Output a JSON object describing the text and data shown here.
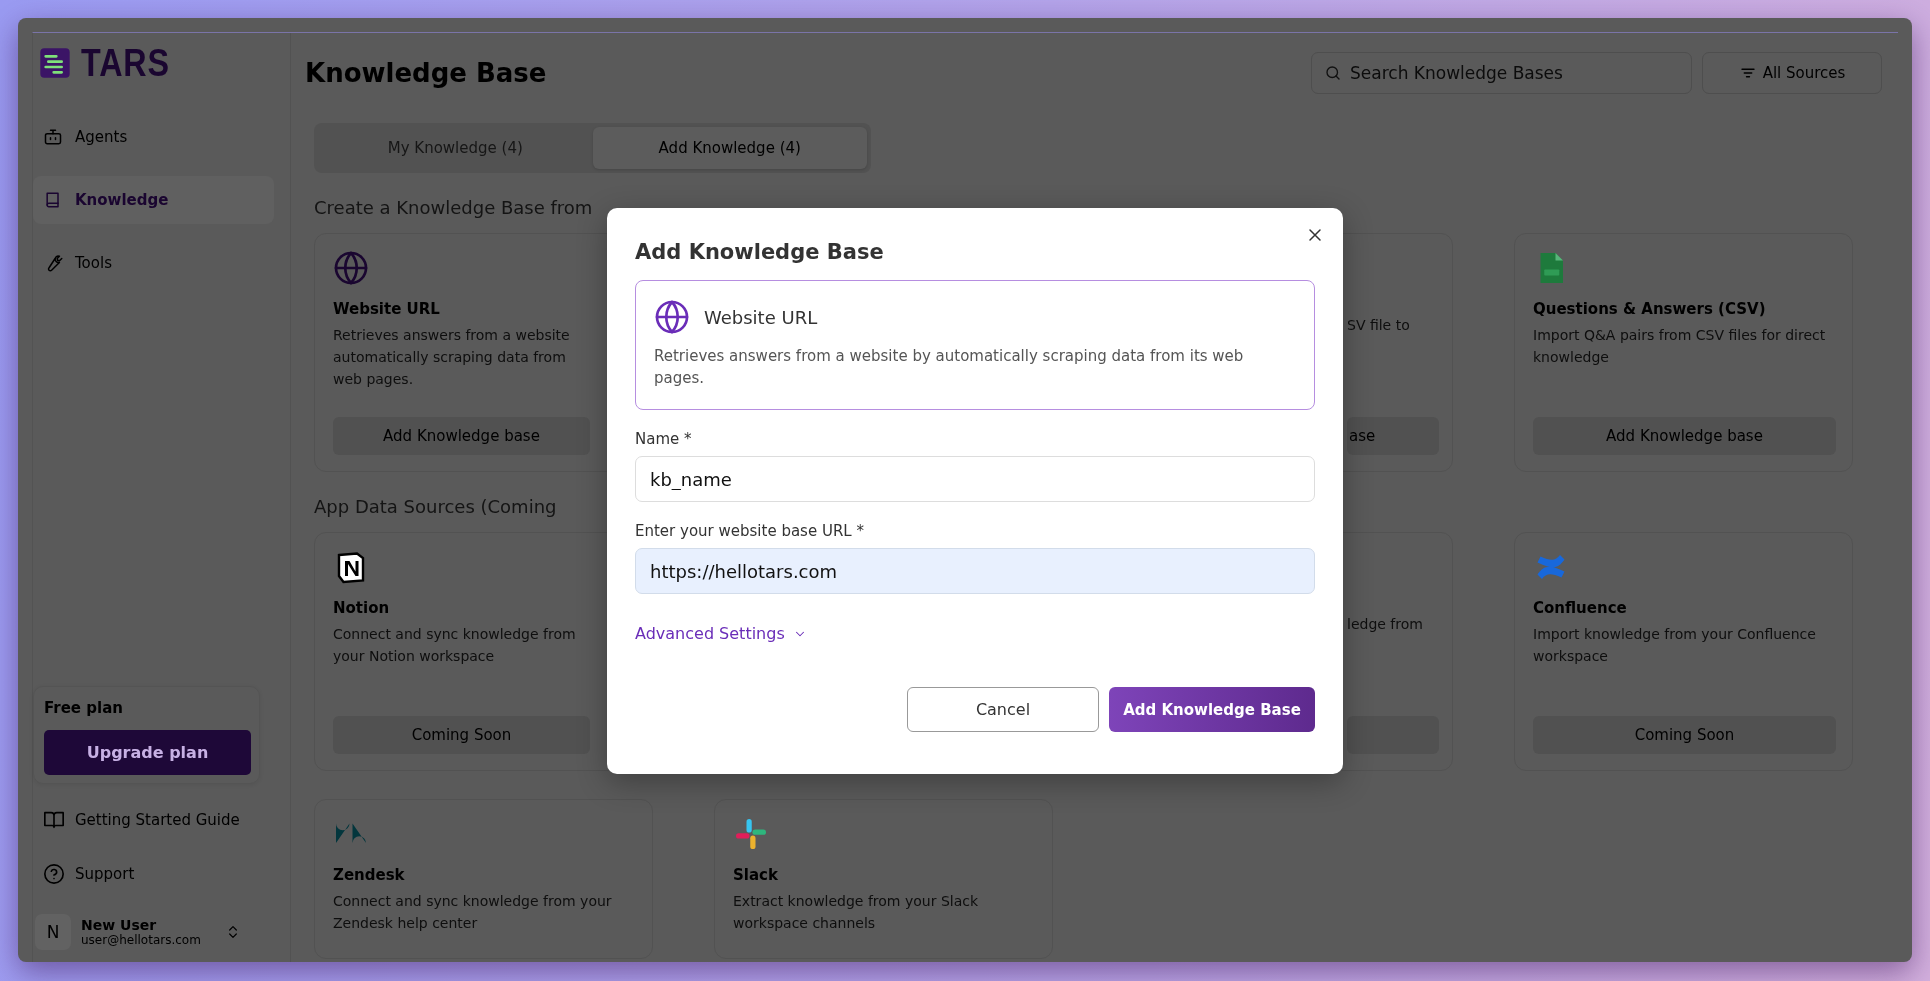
{
  "sidebar": {
    "logo": "TARS",
    "nav": [
      {
        "label": "Agents",
        "selected": false
      },
      {
        "label": "Knowledge",
        "selected": true
      },
      {
        "label": "Tools",
        "selected": false
      }
    ],
    "plan": {
      "title": "Free plan",
      "button": "Upgrade plan"
    },
    "links": [
      "Getting Started Guide",
      "Support"
    ],
    "user": {
      "initial": "N",
      "name": "New User",
      "email": "user@hellotars.com"
    }
  },
  "header": {
    "title": "Knowledge Base",
    "search": {
      "placeholder": "Search Knowledge Bases"
    },
    "filter": "All Sources"
  },
  "tabs": [
    {
      "label": "My Knowledge (4)",
      "selected": false
    },
    {
      "label": "Add Knowledge (4)",
      "selected": true
    }
  ],
  "sections": [
    {
      "heading": "Create a Knowledge Base from",
      "cards": [
        {
          "kind": "globe",
          "title": "Website URL",
          "description": "Retrieves answers from a website automatically scraping data from web pages.",
          "button": "Add Knowledge base",
          "clipped": true
        },
        {
          "kind": "covered"
        },
        {
          "kind": "partial",
          "description": "SV file to",
          "button": "ase"
        },
        {
          "kind": "csv",
          "title": "Questions & Answers (CSV)",
          "description": "Import Q&A pairs from CSV files for direct knowledge",
          "button": "Add Knowledge base"
        }
      ]
    },
    {
      "heading": "App Data Sources (Coming",
      "cards": [
        {
          "kind": "notion",
          "title": "Notion",
          "description": "Connect and sync knowledge from your Notion workspace",
          "button": "Coming Soon",
          "clipped": true
        },
        {
          "kind": "covered"
        },
        {
          "kind": "partial",
          "description": "ledge from",
          "has_button": true
        },
        {
          "kind": "confluence",
          "title": "Confluence",
          "description": "Import knowledge from your Confluence workspace",
          "button": "Coming Soon"
        },
        {
          "kind": "zendesk",
          "title": "Zendesk",
          "description": "Connect and sync knowledge from your Zendesk help center"
        },
        {
          "kind": "slack",
          "title": "Slack",
          "description": "Extract knowledge from your Slack workspace channels"
        }
      ]
    }
  ],
  "modal": {
    "title": "Add Knowledge Base",
    "source": {
      "kind": "globe",
      "title": "Website URL",
      "description": "Retrieves answers from a website by automatically scraping data from its web pages."
    },
    "fields": [
      {
        "label": "Name *",
        "value": "kb_name",
        "autofilled": false
      },
      {
        "label": "Enter your website base URL *",
        "value": "https://hellotars.com",
        "autofilled": true
      }
    ],
    "advanced": {
      "label": "Advanced Settings",
      "expanded": false
    },
    "buttons": [
      {
        "label": "Cancel",
        "kind": "secondary"
      },
      {
        "label": "Add Knowledge Base",
        "kind": "primary"
      }
    ]
  }
}
